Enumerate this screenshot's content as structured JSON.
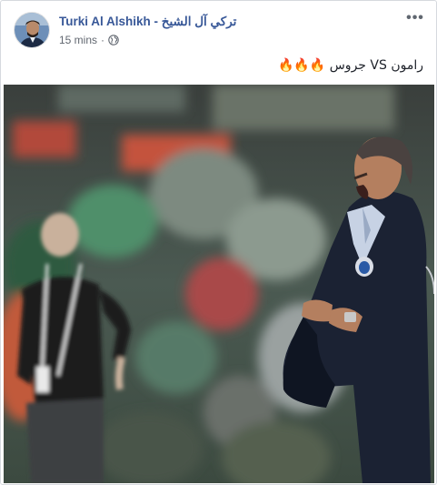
{
  "post": {
    "author": "Turki Al Alshikh - تركي آل الشيخ",
    "time": "15 mins",
    "separator": "·",
    "privacy_icon": "globe-icon",
    "more_icon": "more-options-icon",
    "more_glyph": "•••",
    "text": "رامون VS جروس 🔥🔥🔥"
  },
  "colors": {
    "author_link": "#385898",
    "meta": "#616770",
    "border": "#d6d9de"
  }
}
